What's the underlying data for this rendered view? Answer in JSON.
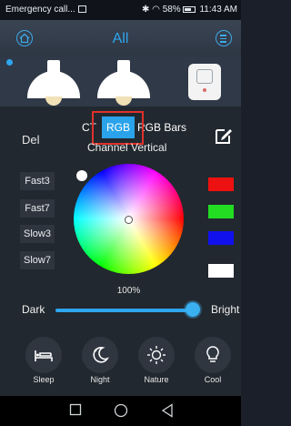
{
  "status_bar": {
    "notification": "Emergency call...",
    "battery": "58%",
    "time": "11:43 AM"
  },
  "header": {
    "title": "All",
    "left_icon": "home-icon",
    "right_icon": "menu-icon"
  },
  "devices": [
    {
      "type": "bulb",
      "selected": true
    },
    {
      "type": "bulb",
      "selected": false
    },
    {
      "type": "plug",
      "selected": false
    }
  ],
  "controls": {
    "del_label": "Del",
    "modes": [
      "CT",
      "RGB",
      "RGB Bars"
    ],
    "active_mode": "RGB",
    "sub_modes": "Channel  Vertical",
    "edit_icon": "edit-icon"
  },
  "speeds": [
    "Fast3",
    "Fast7",
    "Slow3",
    "Slow7"
  ],
  "color_wheel": {
    "brightness_label": "100%"
  },
  "swatches": [
    "#ee1111",
    "#22dd22",
    "#1111ee",
    "#ffffff"
  ],
  "brightness": {
    "min_label": "Dark",
    "max_label": "Bright",
    "value": 0.96
  },
  "scenes": [
    {
      "label": "Sleep",
      "icon": "bed-icon"
    },
    {
      "label": "Night",
      "icon": "moon-icon"
    },
    {
      "label": "Nature",
      "icon": "sun-icon"
    },
    {
      "label": "Cool",
      "icon": "bulb-icon"
    }
  ],
  "colors": {
    "accent": "#2ea6ee",
    "highlight": "#e0312b"
  }
}
